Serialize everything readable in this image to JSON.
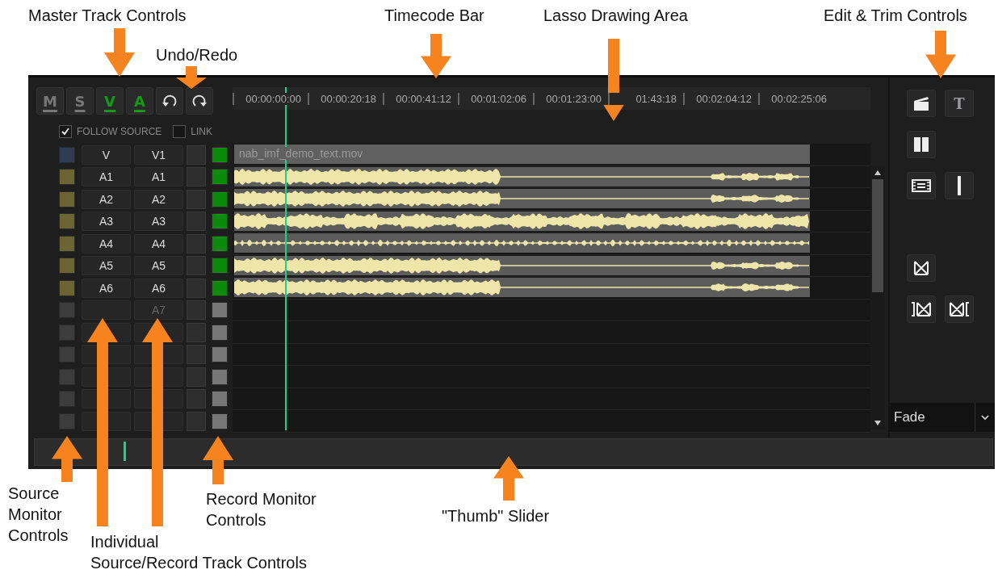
{
  "callouts": [
    {
      "lines": [
        "Master Track Controls"
      ]
    },
    {
      "lines": [
        "Undo/Redo"
      ]
    },
    {
      "lines": [
        "Timecode Bar"
      ]
    },
    {
      "lines": [
        "Lasso Drawing Area"
      ]
    },
    {
      "lines": [
        "Edit & Trim Controls"
      ]
    },
    {
      "lines": [
        "Source",
        "Monitor",
        "Controls"
      ]
    },
    {
      "lines": [
        "Record Monitor",
        "Controls"
      ]
    },
    {
      "lines": [
        "\"Thumb\" Slider"
      ]
    },
    {
      "lines": [
        "Individual",
        "Source/Record Track Controls"
      ]
    }
  ],
  "master_buttons": [
    {
      "label": "M",
      "on": false
    },
    {
      "label": "S",
      "on": false
    },
    {
      "label": "V",
      "on": true
    },
    {
      "label": "A",
      "on": true
    }
  ],
  "history_buttons": [
    {
      "kind": "undo"
    },
    {
      "kind": "redo"
    }
  ],
  "options": [
    {
      "label": "FOLLOW SOURCE",
      "checked": true
    },
    {
      "label": "LINK",
      "checked": false
    }
  ],
  "timecodes": [
    "00:00:00:00",
    "00:00:20:18",
    "00:00:41:12",
    "00:01:02:06",
    "00:01:23:00",
    "01:43:18",
    "00:02:04:12",
    "00:02:25:06"
  ],
  "tracks": [
    {
      "source": "V",
      "record": "V1",
      "color": "#2f3d52",
      "record_on": true,
      "clip": {
        "kind": "video",
        "name": "nab_imf_demo_text.mov"
      }
    },
    {
      "source": "A1",
      "record": "A1",
      "color": "#6b6534",
      "record_on": true,
      "clip": {
        "kind": "audio"
      }
    },
    {
      "source": "A2",
      "record": "A2",
      "color": "#6b6534",
      "record_on": true,
      "clip": {
        "kind": "audio"
      }
    },
    {
      "source": "A3",
      "record": "A3",
      "color": "#6b6534",
      "record_on": true,
      "clip": {
        "kind": "audio"
      }
    },
    {
      "source": "A4",
      "record": "A4",
      "color": "#6b6534",
      "record_on": true,
      "clip": {
        "kind": "audio"
      }
    },
    {
      "source": "A5",
      "record": "A5",
      "color": "#6b6534",
      "record_on": true,
      "clip": {
        "kind": "audio"
      }
    },
    {
      "source": "A6",
      "record": "A6",
      "color": "#6b6534",
      "record_on": true,
      "clip": {
        "kind": "audio"
      }
    },
    {
      "record": "A7",
      "color": "#3c3c3c",
      "record_on": false
    },
    {
      "color": "#3c3c3c",
      "record_on": false
    },
    {
      "color": "#3c3c3c",
      "record_on": false
    },
    {
      "color": "#3c3c3c",
      "record_on": false
    },
    {
      "color": "#3c3c3c",
      "record_on": false
    },
    {
      "color": "#3c3c3c",
      "record_on": false
    }
  ],
  "tools": [
    {
      "kind": "clapper"
    },
    {
      "kind": "text",
      "glyph": "T"
    },
    {
      "kind": "split"
    },
    {
      "kind": "film"
    },
    {
      "kind": "bar"
    },
    {
      "kind": "bowtie"
    },
    {
      "kind": "bowtie_left"
    },
    {
      "kind": "bowtie_right"
    }
  ],
  "transition": {
    "value": "Fade"
  },
  "thumb_slider": {
    "level": 0.093
  }
}
